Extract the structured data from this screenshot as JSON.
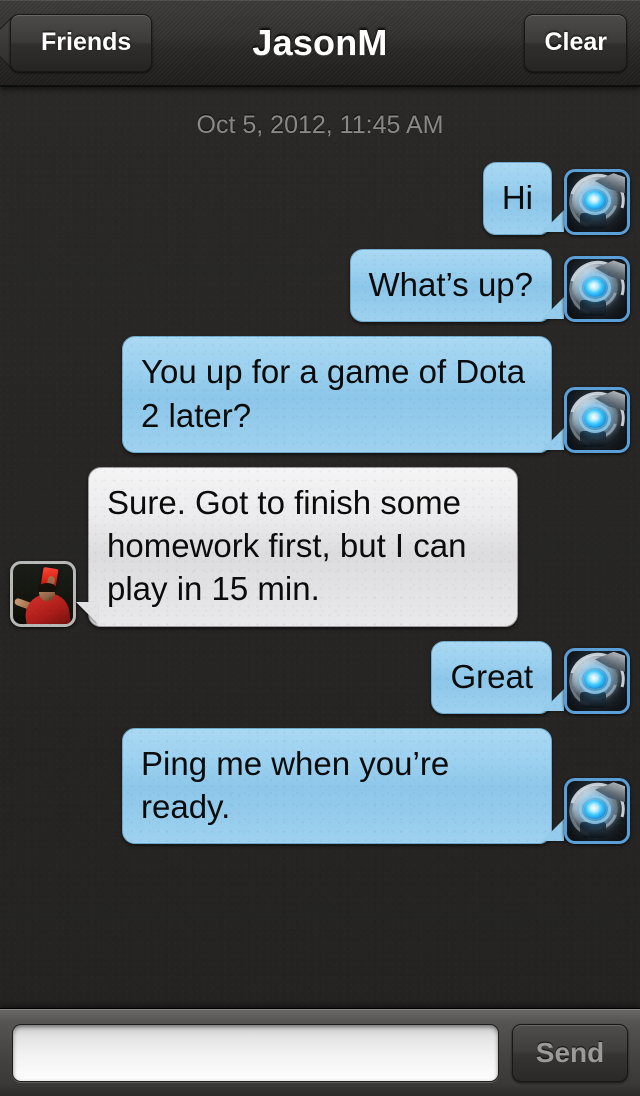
{
  "header": {
    "back_label": "Friends",
    "title": "JasonM",
    "clear_label": "Clear",
    "back_icon": "chevron-left-icon"
  },
  "conversation": {
    "timestamp": "Oct 5, 2012, 11:45 AM",
    "participants": {
      "self": {
        "name": "JasonM",
        "avatar_icon": "robot-eye-avatar"
      },
      "other": {
        "name": "JasonM",
        "avatar_icon": "referee-photo-avatar"
      }
    },
    "messages": [
      {
        "side": "out",
        "text": "Hi",
        "avatar": "robot-eye-avatar"
      },
      {
        "side": "out",
        "text": "What’s up?",
        "avatar": "robot-eye-avatar"
      },
      {
        "side": "out",
        "text": "You up for a game of Dota 2 later?",
        "avatar": "robot-eye-avatar"
      },
      {
        "side": "in",
        "text": "Sure. Got to finish some homework first, but I can play in 15 min.",
        "avatar": "referee-photo-avatar"
      },
      {
        "side": "out",
        "text": "Great",
        "avatar": "robot-eye-avatar"
      },
      {
        "side": "out",
        "text": "Ping me when you’re ready.",
        "avatar": "robot-eye-avatar"
      }
    ]
  },
  "composer": {
    "input_value": "",
    "input_placeholder": "",
    "send_label": "Send"
  },
  "colors": {
    "outgoing_bubble": "#8cc6e9",
    "incoming_bubble": "#e3e3e5",
    "chat_background": "#272624",
    "navbar_background": "#343331",
    "avatar_border_blue": "#5b9fd8",
    "send_label": "#9b9a98",
    "timestamp": "#8a8884"
  }
}
